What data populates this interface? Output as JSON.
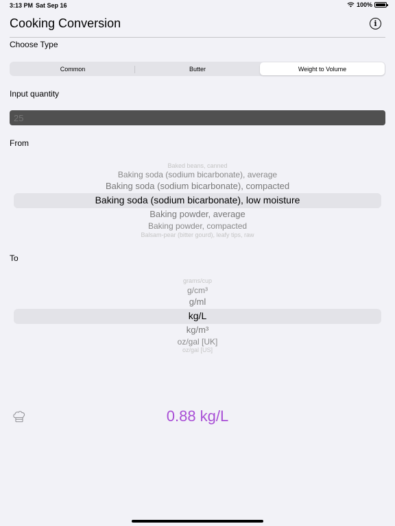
{
  "status_bar": {
    "time": "3:13 PM",
    "date": "Sat Sep 16",
    "battery": "100%"
  },
  "header": {
    "title": "Cooking Conversion",
    "info_icon": "info-circle-icon"
  },
  "type_section": {
    "label": "Choose Type",
    "segments": [
      "Common",
      "Butter",
      "Weight to Volume"
    ],
    "selected": "Weight to Volume"
  },
  "input": {
    "label": "Input quantity",
    "placeholder": "25",
    "value": ""
  },
  "from": {
    "label": "From",
    "items": [
      "Baked beans, canned",
      "Baking soda (sodium bicarbonate), average",
      "Baking soda (sodium bicarbonate), compacted",
      "Baking soda (sodium bicarbonate), low moisture",
      "Baking powder, average",
      "Baking powder, compacted",
      "Balsam-pear (bitter gourd), leafy tips, raw"
    ],
    "selected": "Baking soda (sodium bicarbonate), low moisture"
  },
  "to": {
    "label": "To",
    "items": [
      "grams/cup",
      "g/cm³",
      "g/ml",
      "kg/L",
      "kg/m³",
      "oz/gal [UK]",
      "oz/gal [US]"
    ],
    "selected": "kg/L"
  },
  "result": {
    "text": "0.88 kg/L",
    "color": "#a94fd6",
    "icon": "chef-hat-icon"
  }
}
